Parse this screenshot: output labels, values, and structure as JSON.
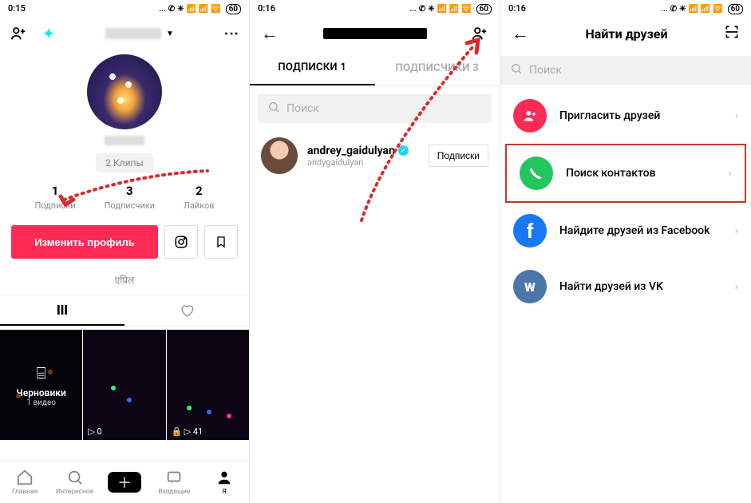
{
  "statusbar": {
    "time1": "0:15",
    "time2": "0:16",
    "time3": "0:16",
    "batt": "60"
  },
  "p1": {
    "clips": "2 Клипы",
    "stats": [
      {
        "n": "1",
        "l": "Подписки"
      },
      {
        "n": "3",
        "l": "Подписчики"
      },
      {
        "n": "2",
        "l": "Лайков"
      }
    ],
    "edit": "Изменить профиль",
    "hindi": "एप्रिल",
    "drafts_t": "Черновики",
    "drafts_s": "1 видео",
    "views2": "▷ 0",
    "views3": "▷ 41",
    "nav": [
      "Главная",
      "Интересное",
      "",
      "Входящие",
      "Я"
    ]
  },
  "p2": {
    "tab_a": "ПОДПИСКИ 1",
    "tab_b": "ПОДПИСЧИКИ 3",
    "search": "Поиск",
    "user_n": "andrey_gaidulyan",
    "user_s": "andygaidulyan",
    "follow": "Подписки"
  },
  "p3": {
    "title": "Найти друзей",
    "search": "Поиск",
    "opts": [
      "Пригласить друзей",
      "Поиск контактов",
      "Найдите друзей из Facebook",
      "Найти друзей из VK"
    ]
  }
}
